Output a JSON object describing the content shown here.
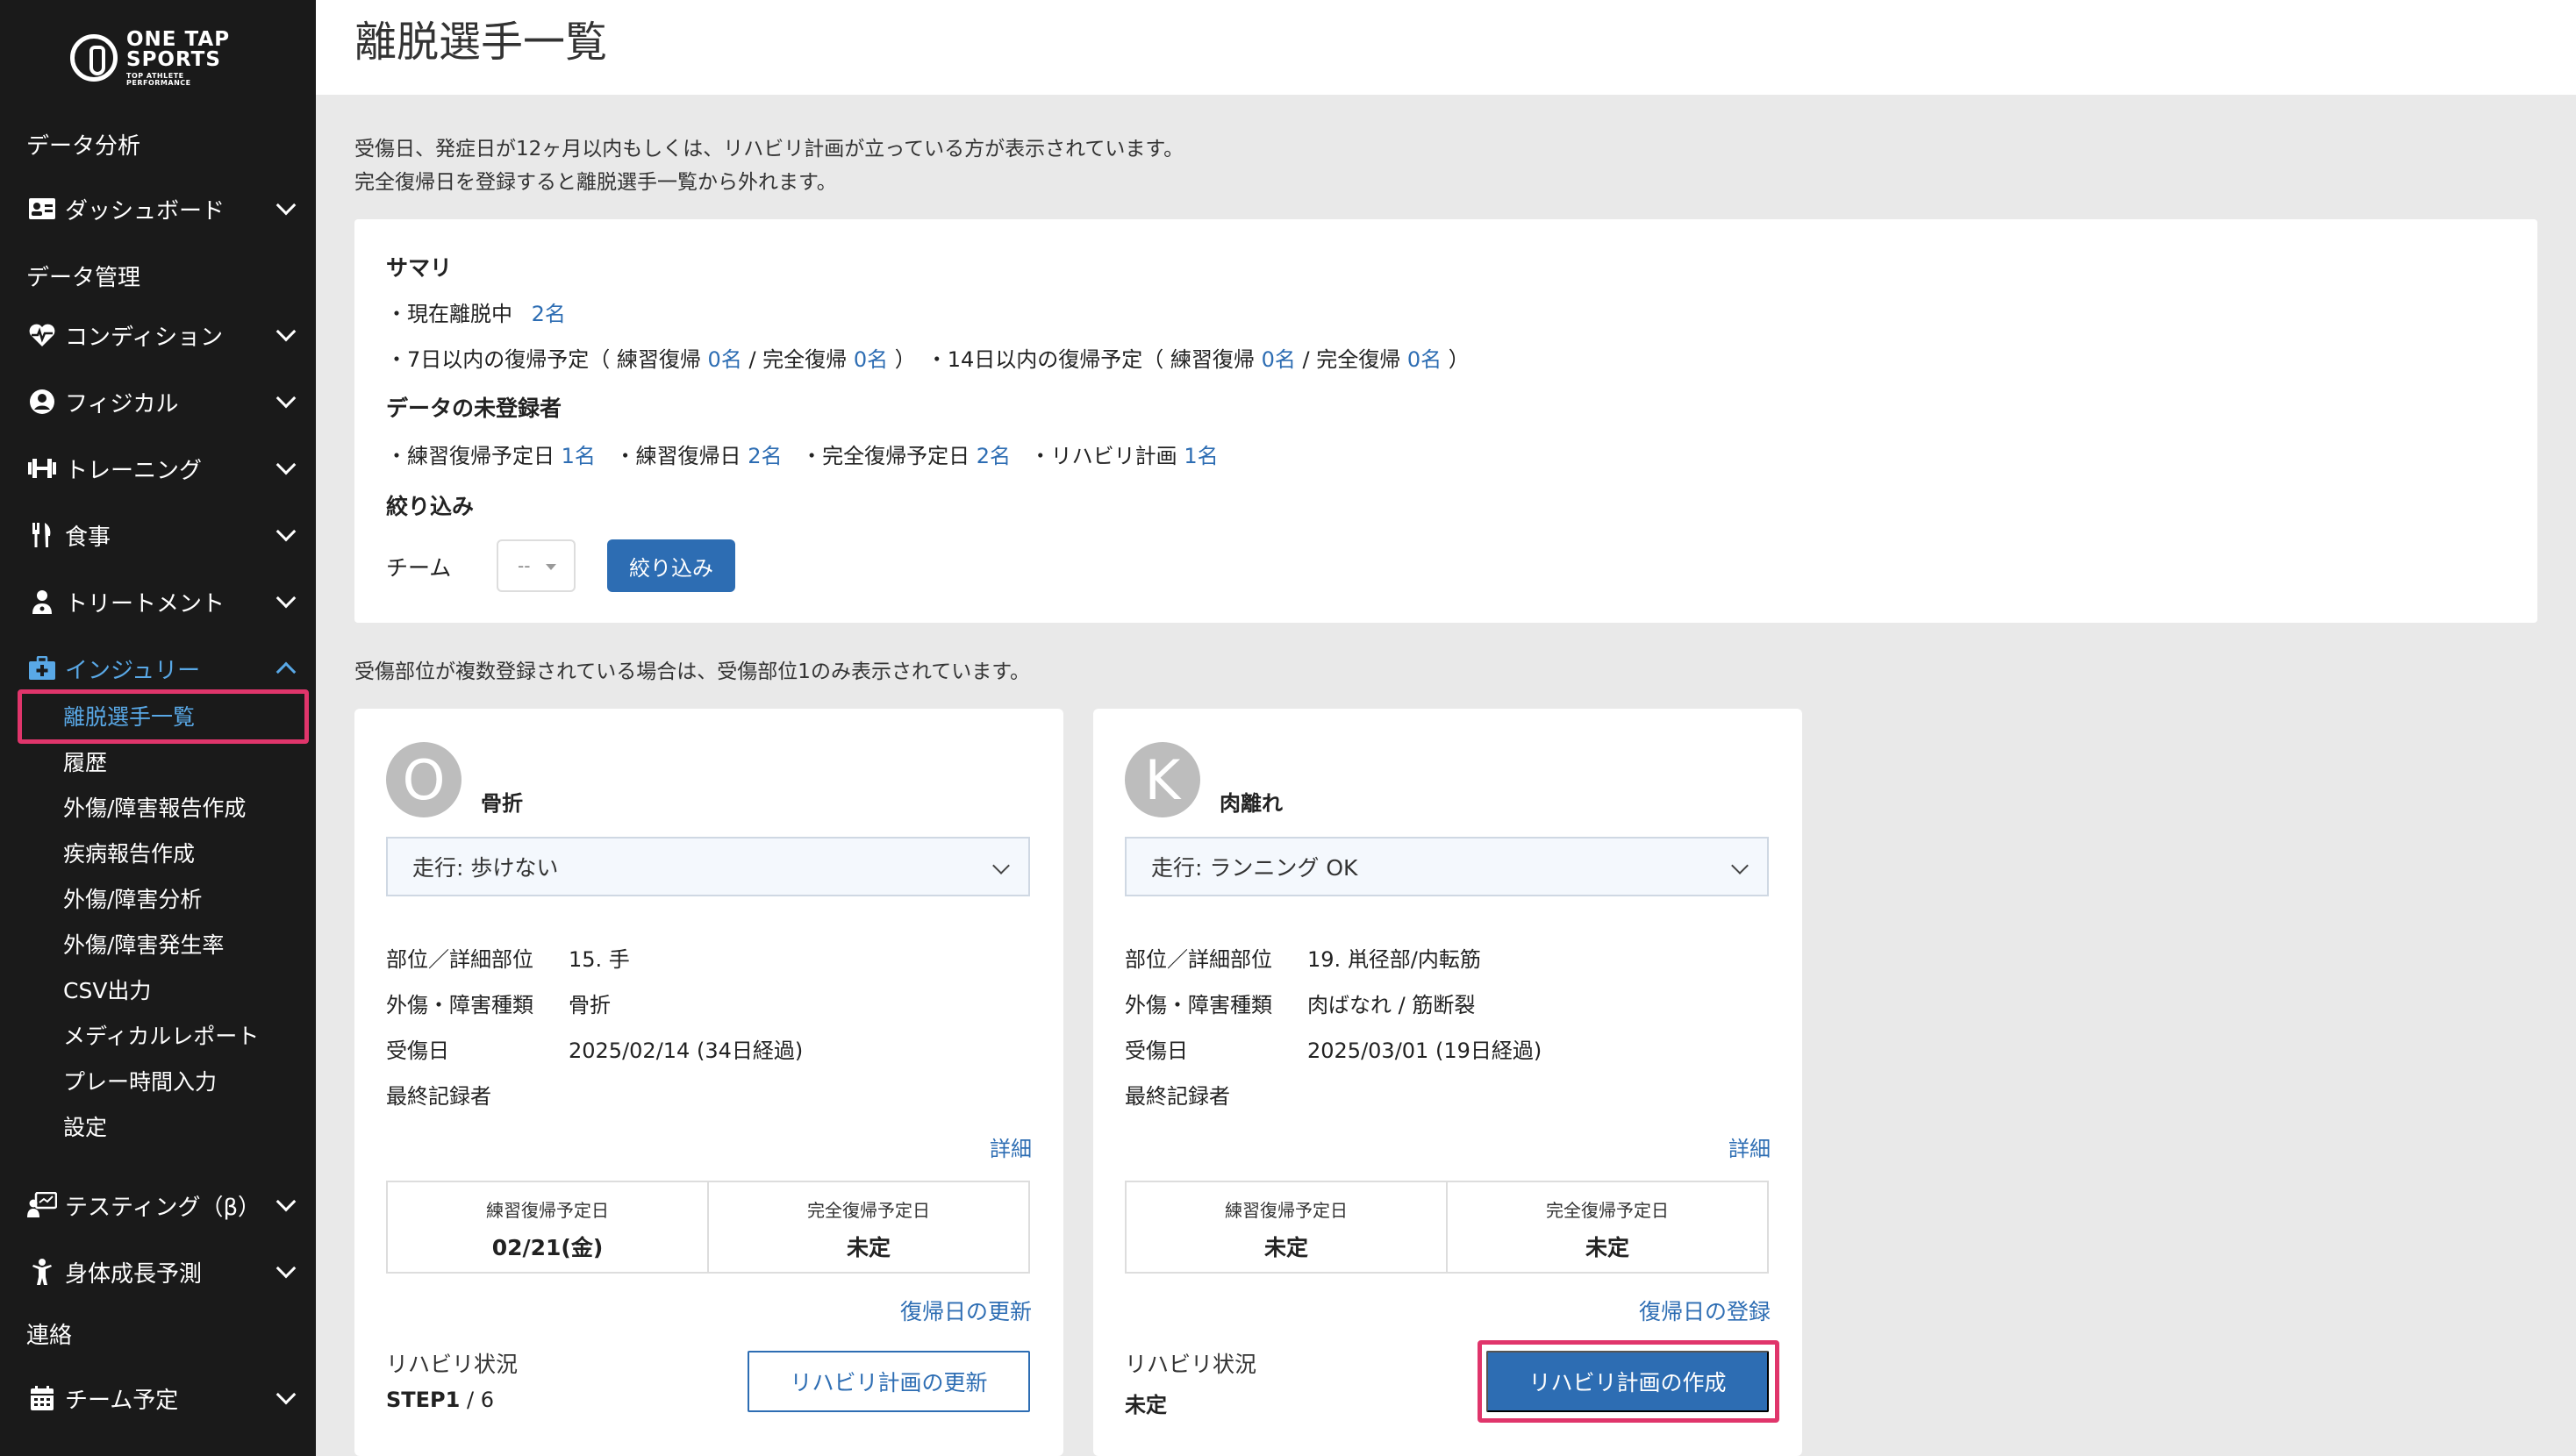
{
  "logo": {
    "line1": "ONE TAP",
    "line2": "SPORTS",
    "line3": "TOP ATHLETE PERFORMANCE"
  },
  "sidebar": {
    "items": [
      {
        "label": "データ分析"
      },
      {
        "label": "ダッシュボード",
        "icon": "id-card-icon"
      },
      {
        "label": "データ管理"
      },
      {
        "label": "コンディション",
        "icon": "heartbeat-icon"
      },
      {
        "label": "フィジカル",
        "icon": "user-circle-icon"
      },
      {
        "label": "トレーニング",
        "icon": "dumbbell-icon"
      },
      {
        "label": "食事",
        "icon": "utensils-icon"
      },
      {
        "label": "トリートメント",
        "icon": "user-doctor-icon"
      },
      {
        "label": "インジュリー",
        "icon": "first-aid-kit-icon"
      },
      {
        "label": "テスティング（β）",
        "icon": "chalkboard-user-icon"
      },
      {
        "label": "身体成長予測",
        "icon": "child-icon"
      },
      {
        "label": "連絡"
      },
      {
        "label": "チーム予定",
        "icon": "calendar-icon"
      }
    ],
    "injury_sub": [
      "離脱選手一覧",
      "履歴",
      "外傷/障害報告作成",
      "疾病報告作成",
      "外傷/障害分析",
      "外傷/障害発生率",
      "CSV出力",
      "メディカルレポート",
      "プレー時間入力",
      "設定"
    ]
  },
  "page": {
    "title": "離脱選手一覧",
    "notice1": "受傷日、発症日が12ヶ月以内もしくは、リハビリ計画が立っている方が表示されています。",
    "notice2": "完全復帰日を登録すると離脱選手一覧から外れます。",
    "notice3": "受傷部位が複数登録されている場合は、受傷部位1のみ表示されています。"
  },
  "summary": {
    "heading": "サマリ",
    "current_prefix": "・現在離脱中",
    "current_count": "2名",
    "row2": {
      "a": "・7日以内の復帰予定（ 練習復帰",
      "a_count": "0名",
      "b": " / 完全復帰",
      "b_count": "0名",
      "c": "）　・14日以内の復帰予定（ 練習復帰",
      "c_count": "0名",
      "d": " / 完全復帰",
      "d_count": "0名",
      "e": "）"
    },
    "unregistered_heading": "データの未登録者",
    "unreg": {
      "a": "・練習復帰予定日",
      "a_count": "1名",
      "b": "・練習復帰日",
      "b_count": "2名",
      "c": "・完全復帰予定日",
      "c_count": "2名",
      "d": "・リハビリ計画",
      "d_count": "1名"
    },
    "filter_heading": "絞り込み",
    "team_label": "チーム",
    "team_value": "--",
    "filter_button": "絞り込み"
  },
  "cards": [
    {
      "initial": "O",
      "title": "骨折",
      "status": "走行: 歩けない",
      "part_label": "部位／詳細部位",
      "part_value": "15. 手",
      "type_label": "外傷・障害種類",
      "type_value": "骨折",
      "date_label": "受傷日",
      "date_value": "2025/02/14 (34日経過)",
      "recorder_label": "最終記録者",
      "recorder_value": "",
      "detail": "詳細",
      "practice_label": "練習復帰予定日",
      "practice_value": "02/21(金)",
      "full_label": "完全復帰予定日",
      "full_value": "未定",
      "return_link": "復帰日の更新",
      "rehab_label": "リハビリ状況",
      "rehab_value": "STEP1",
      "rehab_total": " / 6",
      "rehab_button": "リハビリ計画の更新"
    },
    {
      "initial": "K",
      "title": "肉離れ",
      "status": "走行: ランニング OK",
      "part_label": "部位／詳細部位",
      "part_value": "19. 鼡径部/内転筋",
      "type_label": "外傷・障害種類",
      "type_value": "肉ばなれ / 筋断裂",
      "date_label": "受傷日",
      "date_value": "2025/03/01 (19日経過)",
      "recorder_label": "最終記録者",
      "recorder_value": "",
      "detail": "詳細",
      "practice_label": "練習復帰予定日",
      "practice_value": "未定",
      "full_label": "完全復帰予定日",
      "full_value": "未定",
      "return_link": "復帰日の登録",
      "rehab_label": "リハビリ状況",
      "rehab_value": "未定",
      "rehab_button": "リハビリ計画の作成"
    }
  ],
  "colors": {
    "accent": "#2d6db3",
    "highlight": "#e0356b",
    "sidebar_bg": "#1a1a1a",
    "active": "#59a8e6"
  }
}
